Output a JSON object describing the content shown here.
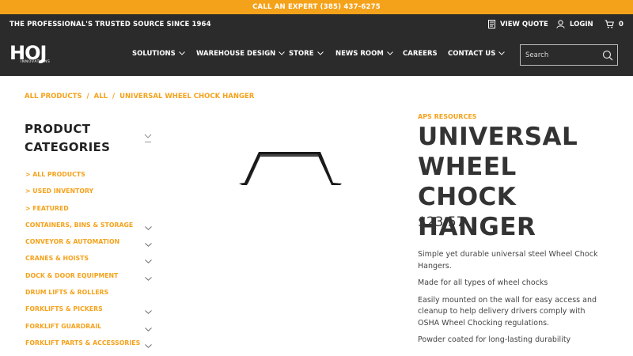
{
  "topbar": {
    "text": "CALL AN EXPERT (385) 437-6275"
  },
  "header": {
    "tagline": "THE PROFESSIONAL'S TRUSTED SOURCE SINCE 1964",
    "view_quote": "VIEW QUOTE",
    "login": "LOGIN",
    "cart_count": "0",
    "logo_main": "HOJ",
    "logo_sub": "INNOVATIONS"
  },
  "nav": {
    "items": [
      {
        "label": "SOLUTIONS"
      },
      {
        "label": "WAREHOUSE DESIGN"
      },
      {
        "label": "STORE"
      },
      {
        "label": "NEWS ROOM"
      },
      {
        "label": "CAREERS"
      },
      {
        "label": "CONTACT US"
      }
    ]
  },
  "search": {
    "placeholder": "Search"
  },
  "breadcrumb": {
    "items": [
      "ALL PRODUCTS",
      "ALL",
      "UNIVERSAL WHEEL CHOCK HANGER"
    ],
    "sep": "/"
  },
  "sidebar": {
    "title": "PRODUCT CATEGORIES",
    "items": [
      {
        "label": "> ALL PRODUCTS"
      },
      {
        "label": "> USED INVENTORY"
      },
      {
        "label": "> FEATURED"
      },
      {
        "label": "CONTAINERS, BINS & STORAGE"
      },
      {
        "label": "CONVEYOR & AUTOMATION"
      },
      {
        "label": "CRANES & HOISTS"
      },
      {
        "label": "DOCK & DOOR EQUIPMENT"
      },
      {
        "label": "DRUM LIFTS & ROLLERS"
      },
      {
        "label": "FORKLIFTS & PICKERS"
      },
      {
        "label": "FORKLIFT GUARDRAIL"
      },
      {
        "label": "FORKLIFT PARTS & ACCESSORIES"
      }
    ]
  },
  "product": {
    "vendor": "APS RESOURCES",
    "title": "UNIVERSAL WHEEL CHOCK HANGER",
    "price": "$23.57",
    "description": [
      "Simple yet durable universal steel Wheel Chock Hangers.",
      "Made for all types of wheel chocks",
      "Easily mounted on the wall for easy access and cleanup to help delivery drivers comply with OSHA Wheel Chocking regulations.",
      "Powder coated for long-lasting durability"
    ]
  },
  "colors": {
    "accent": "#f5a21b",
    "header_bg": "#2b2b2b",
    "text": "#333333"
  }
}
